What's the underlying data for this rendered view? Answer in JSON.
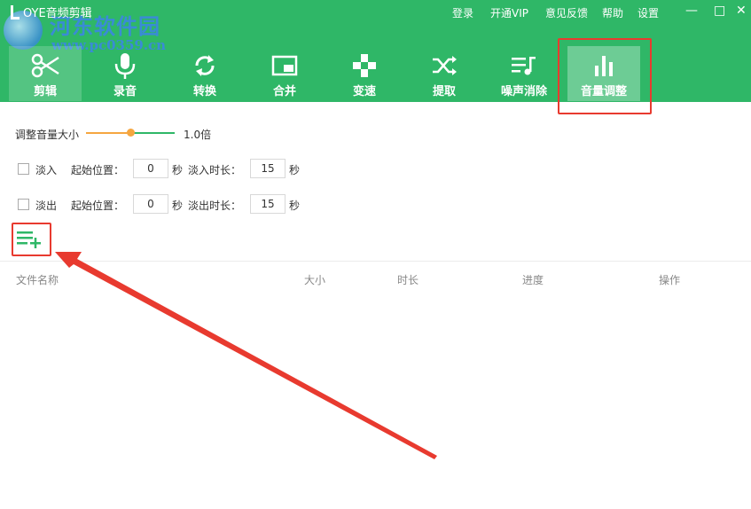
{
  "app": {
    "title": "OYE音频剪辑"
  },
  "watermark": {
    "name": "河东软件园",
    "url": "www.pc0359.cn"
  },
  "top_menu": [
    "登录",
    "开通VIP",
    "意见反馈",
    "帮助",
    "设置"
  ],
  "window_controls": {
    "minimize": "—",
    "maximize": "□",
    "close": "✕"
  },
  "tabs": [
    {
      "label": "剪辑",
      "icon": "scissors-icon"
    },
    {
      "label": "录音",
      "icon": "microphone-icon"
    },
    {
      "label": "转换",
      "icon": "refresh-icon"
    },
    {
      "label": "合并",
      "icon": "picture-in-picture-icon"
    },
    {
      "label": "变速",
      "icon": "gamepad-icon"
    },
    {
      "label": "提取",
      "icon": "shuffle-icon"
    },
    {
      "label": "噪声消除",
      "icon": "playlist-music-icon"
    },
    {
      "label": "音量调整",
      "icon": "bar-chart-icon"
    }
  ],
  "volume": {
    "label": "调整音量大小",
    "value": "1.0倍",
    "level": 0.5
  },
  "fade_in": {
    "label": "淡入",
    "start_label": "起始位置：",
    "start_value": "0",
    "unit": "秒",
    "duration_label": "淡入时长：",
    "duration_value": "15"
  },
  "fade_out": {
    "label": "淡出",
    "start_label": "起始位置：",
    "start_value": "0",
    "unit": "秒",
    "duration_label": "淡出时长：",
    "duration_value": "15"
  },
  "file_table": {
    "columns": [
      "文件名称",
      "大小",
      "时长",
      "进度",
      "操作"
    ]
  },
  "colors": {
    "brand": "#2fb767",
    "highlight": "#e83a2f",
    "slider_active": "#f5a640"
  }
}
